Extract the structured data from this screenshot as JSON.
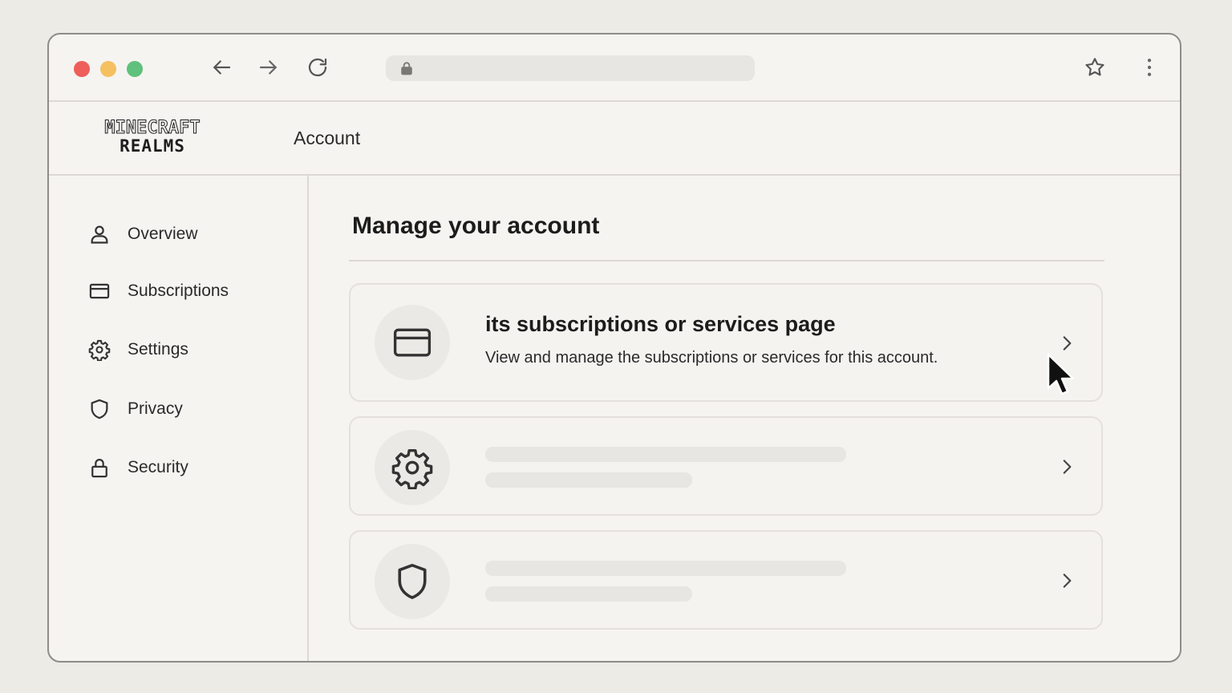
{
  "browser": {
    "url": "",
    "colors": {
      "close": "#ee5e5a",
      "minimize": "#f4c060",
      "maximize": "#5fc17c"
    }
  },
  "header": {
    "logo": {
      "line1": "MINECRAFT",
      "line2": "REALMS"
    },
    "title": "Account"
  },
  "sidebar": {
    "items": [
      {
        "label": "Overview",
        "icon": "person-icon"
      },
      {
        "label": "Subscriptions",
        "icon": "card-icon"
      },
      {
        "label": "Settings",
        "icon": "gear-icon"
      },
      {
        "label": "Privacy",
        "icon": "shield-icon"
      },
      {
        "label": "Security",
        "icon": "lock-icon"
      }
    ]
  },
  "main": {
    "title": "Manage your account",
    "cards": [
      {
        "icon": "card-icon",
        "title": "its subscriptions or services page",
        "description": "View and manage the subscriptions or services for this account."
      },
      {
        "icon": "gear-icon",
        "title": "",
        "description": ""
      },
      {
        "icon": "shield-icon",
        "title": "",
        "description": ""
      }
    ]
  }
}
